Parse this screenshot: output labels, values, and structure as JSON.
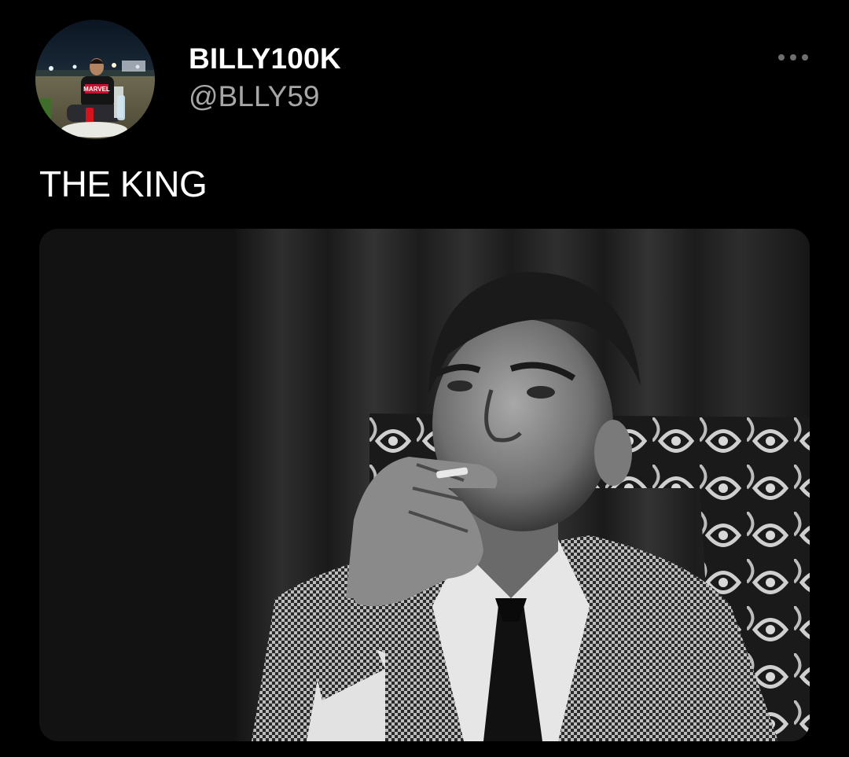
{
  "tweet": {
    "display_name": "BILLY100K",
    "handle": "@BLLY59",
    "text": "THE KING"
  },
  "avatar": {
    "shirt_text": "MARVEL"
  },
  "icons": {
    "avatar": "profile-photo",
    "more": "more-dots-icon"
  },
  "colors": {
    "background": "#000000",
    "name": "#ffffff",
    "handle": "#a7a7a7"
  }
}
